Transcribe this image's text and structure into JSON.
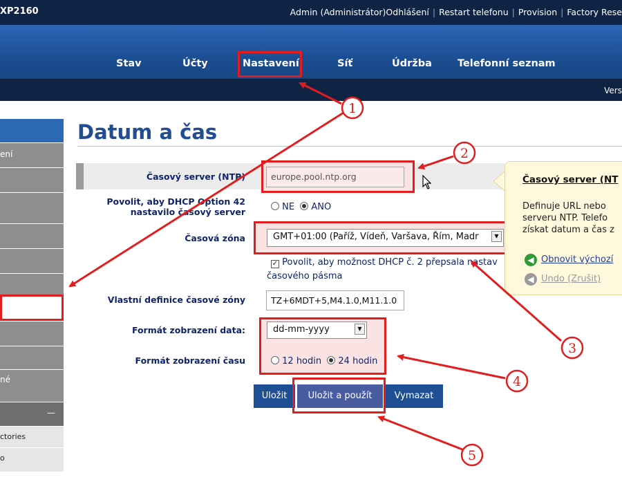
{
  "header": {
    "model": "XP2160",
    "links": [
      "Admin (Administrátor)",
      "Odhlášení",
      "Restart telefonu",
      "Provision",
      "Factory Rese"
    ]
  },
  "nav": {
    "tabs": [
      "Stav",
      "Účty",
      "Nastavení",
      "Síť",
      "Údržba",
      "Telefonní seznam"
    ],
    "active": "Nastavení"
  },
  "subbar": {
    "version": "Vers"
  },
  "sidebar": {
    "items": [
      "",
      "ení",
      "",
      "",
      "",
      "",
      "",
      "",
      "",
      "",
      "né",
      "—",
      "ctories",
      "o"
    ]
  },
  "page": {
    "title": "Datum a čas"
  },
  "form": {
    "ntp_label": "Časový server (NTP)",
    "ntp_value": "europe.pool.ntp.org",
    "dhcp42_label_line1": "Povolit, aby DHCP Option 42",
    "dhcp42_label_line2": "nastavilo časový server",
    "opt_ne": "NE",
    "opt_ano": "ANO",
    "dhcp42_selected": "ANO",
    "tz_label": "Časová zóna",
    "tz_value": "GMT+01:00 (Paříž, Vídeň, Varšava, Řím, Madr",
    "dhcp2_line1": "Povolit, aby možnost DHCP č. 2 přepsala nastav",
    "dhcp2_line2": "časového pásma",
    "dhcp2_checked": true,
    "custom_tz_label": "Vlastní definice časové zóny",
    "custom_tz_value": "TZ+6MDT+5,M4.1.0,M11.1.0",
    "date_fmt_label": "Formát zobrazení data:",
    "date_fmt_value": "dd-mm-yyyy",
    "time_fmt_label": "Formát zobrazení času",
    "opt_12": "12 hodin",
    "opt_24": "24 hodin",
    "time_selected": "24 hodin"
  },
  "buttons": {
    "save": "Uložit",
    "save_apply": "Uložit a použít",
    "clear": "Vymazat"
  },
  "tooltip": {
    "title": "Časový server (NT",
    "body": [
      "Definuje URL nebo",
      "serveru NTP. Telefo",
      "získat datum a čas z"
    ],
    "restore": "Obnovit výchozí",
    "undo": "Undo (Zrušit)"
  },
  "annotations": {
    "numbers": [
      "1",
      "2",
      "3",
      "4",
      "5"
    ],
    "color": "#e21d1d"
  }
}
